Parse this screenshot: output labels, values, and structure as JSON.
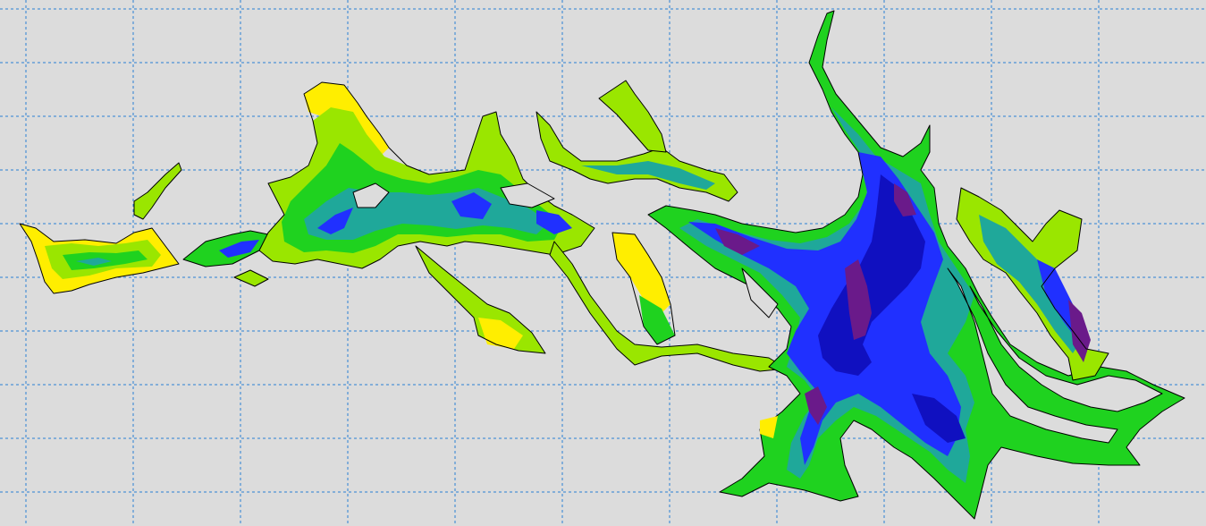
{
  "map": {
    "background": "#dcdcdc",
    "grid": {
      "visible": true,
      "style": "dashed",
      "color": "#2a7fd4"
    },
    "palette": {
      "level1": "#ffee00",
      "level2": "#9ae600",
      "level3": "#1fd21f",
      "level4": "#1fa89a",
      "level5": "#2030ff",
      "level6": "#1010c0",
      "level7": "#6a1a8a"
    }
  }
}
